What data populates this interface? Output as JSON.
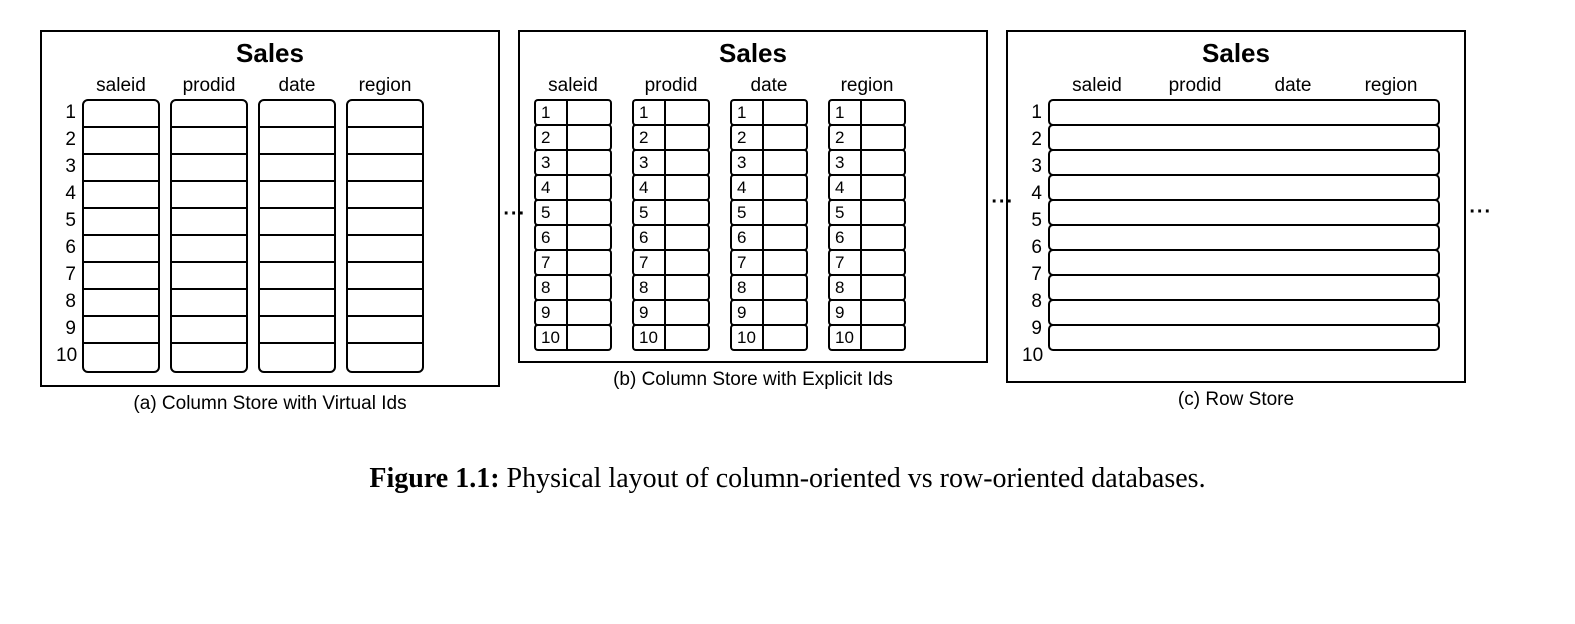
{
  "title": "Sales",
  "columns": [
    "saleid",
    "prodid",
    "date",
    "region"
  ],
  "row_ids": [
    1,
    2,
    3,
    4,
    5,
    6,
    7,
    8,
    9,
    10
  ],
  "ellipsis": "...",
  "panels": {
    "a": {
      "caption": "(a) Column Store with Virtual Ids"
    },
    "b": {
      "caption": "(b) Column Store with Explicit Ids"
    },
    "c": {
      "caption": "(c) Row  Store"
    }
  },
  "figure": {
    "number": "Figure 1.1:",
    "text": "Physical layout of column-oriented vs row-oriented databases."
  },
  "chart_data": {
    "type": "table",
    "description": "Schematic: three physical layouts of a Sales table with 10 rows and 4 columns.",
    "table_name": "Sales",
    "columns": [
      "saleid",
      "prodid",
      "date",
      "region"
    ],
    "row_count": 10,
    "layouts": [
      {
        "label": "(a) Column Store with Virtual Ids",
        "per_column_ids": false,
        "row_ids_external": true
      },
      {
        "label": "(b) Column Store with Explicit Ids",
        "per_column_ids": true,
        "ids": [
          1,
          2,
          3,
          4,
          5,
          6,
          7,
          8,
          9,
          10
        ]
      },
      {
        "label": "(c) Row Store",
        "per_column_ids": false,
        "row_ids_external": true
      }
    ]
  }
}
